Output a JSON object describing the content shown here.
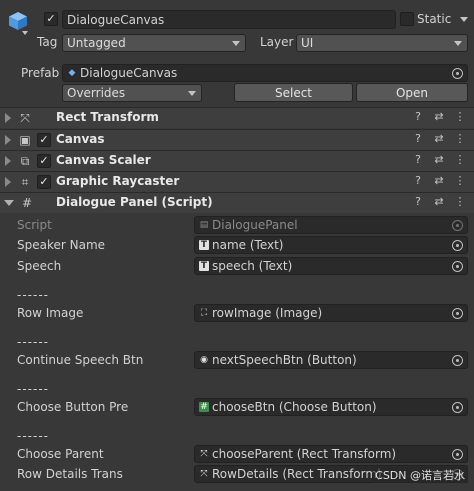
{
  "header": {
    "object_name": "DialogueCanvas",
    "static_label": "Static",
    "tag_label": "Tag",
    "tag_value": "Untagged",
    "layer_label": "Layer",
    "layer_value": "UI",
    "prefab_label": "Prefab",
    "prefab_value": "DialogueCanvas",
    "overrides_value": "Overrides",
    "select_label": "Select",
    "open_label": "Open"
  },
  "components": [
    {
      "title": "Rect Transform"
    },
    {
      "title": "Canvas"
    },
    {
      "title": "Canvas Scaler"
    },
    {
      "title": "Graphic Raycaster"
    },
    {
      "title": "Dialogue Panel (Script)"
    }
  ],
  "script_panel": {
    "script_label": "Script",
    "script_value": "DialoguePanel",
    "speaker_label": "Speaker Name",
    "speaker_value": "name (Text)",
    "speech_label": "Speech",
    "speech_value": "speech (Text)",
    "sep1": "------",
    "row_image_label": "Row Image",
    "row_image_value": "rowImage (Image)",
    "sep2": "------",
    "continue_label": "Continue Speech Btn",
    "continue_value": "nextSpeechBtn (Button)",
    "sep3": "------",
    "choose_btn_label": "Choose Button Pre",
    "choose_btn_value": "chooseBtn (Choose Button)",
    "sep4": "------",
    "choose_parent_label": "Choose Parent",
    "choose_parent_value": "chooseParent (Rect Transform)",
    "row_details_label": "Row Details Trans",
    "row_details_value": "RowDetails (Rect Transform)"
  },
  "watermark": "CSDN @诺言若水",
  "icons": {
    "help": "?",
    "settings": "⇄",
    "more": "⋮"
  }
}
